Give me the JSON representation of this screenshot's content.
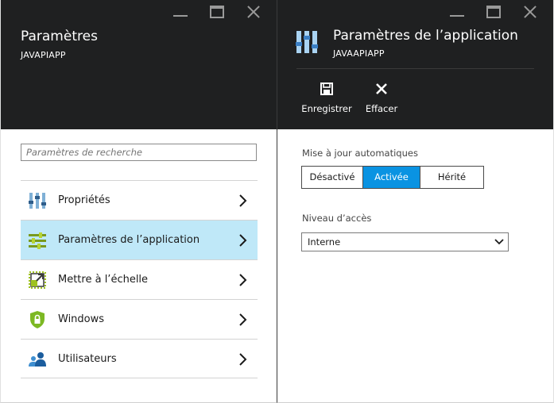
{
  "left_blade": {
    "title": "Paramètres",
    "subtitle": "JAVAPIAPP",
    "search": {
      "placeholder": "Paramètres de recherche",
      "value": ""
    },
    "menu": [
      {
        "label": "Propriétés",
        "icon": "properties-sliders-icon"
      },
      {
        "label": "Paramètres de l’application",
        "icon": "app-settings-icon",
        "selected": true
      },
      {
        "label": "Mettre à l’échelle",
        "icon": "scale-icon"
      },
      {
        "label": "Windows",
        "icon": "windows-shield-icon"
      },
      {
        "label": "Utilisateurs",
        "icon": "users-icon"
      }
    ]
  },
  "right_blade": {
    "title": "Paramètres de l’application",
    "subtitle": "JAVAAPIAPP",
    "commands": {
      "save_label": "Enregistrer",
      "discard_label": "Effacer"
    },
    "auto_update": {
      "label": "Mise à jour automatiques",
      "options": [
        "Désactivé",
        "Activée",
        "Hérité"
      ],
      "selected": "Activée"
    },
    "access_level": {
      "label": "Niveau d’accès",
      "value": "Interne"
    }
  },
  "colors": {
    "header_bg": "#1f2021",
    "accent": "#0a93e2",
    "selected_row": "#bfe8f8"
  }
}
